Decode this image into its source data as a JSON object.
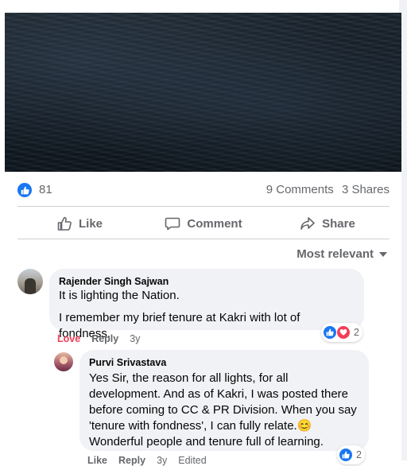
{
  "post": {
    "reactions": {
      "count": "81",
      "types": [
        "like"
      ]
    },
    "comments_count": "9 Comments",
    "shares_count": "3 Shares"
  },
  "actions": {
    "like": "Like",
    "comment": "Comment",
    "share": "Share"
  },
  "sort": {
    "label": "Most relevant"
  },
  "comments": [
    {
      "author": "Rajender Singh Sajwan",
      "lines": [
        "It is lighting the Nation.",
        "I remember my brief tenure at Kakri with lot of fondness."
      ],
      "reaction_label": "Love",
      "reply_label": "Reply",
      "time": "3y",
      "reactions": {
        "count": "2",
        "types": [
          "like",
          "love"
        ]
      }
    },
    {
      "author": "Purvi Srivastava",
      "text": "Yes Sir, the reason for all lights, for all development. And as of Kakri, I was posted there before coming to CC & PR Division. When you say 'tenure with fondness', I can fully relate.😊 Wonderful people and tenure full of learning.",
      "like_label": "Like",
      "reply_label": "Reply",
      "time": "3y",
      "edited": "Edited",
      "reactions": {
        "count": "2",
        "types": [
          "like"
        ]
      }
    }
  ],
  "colors": {
    "facebook_blue": "#1877f2",
    "love_red": "#f33e58",
    "meta_gray": "#65676b",
    "bubble_bg": "#f0f2f5"
  }
}
